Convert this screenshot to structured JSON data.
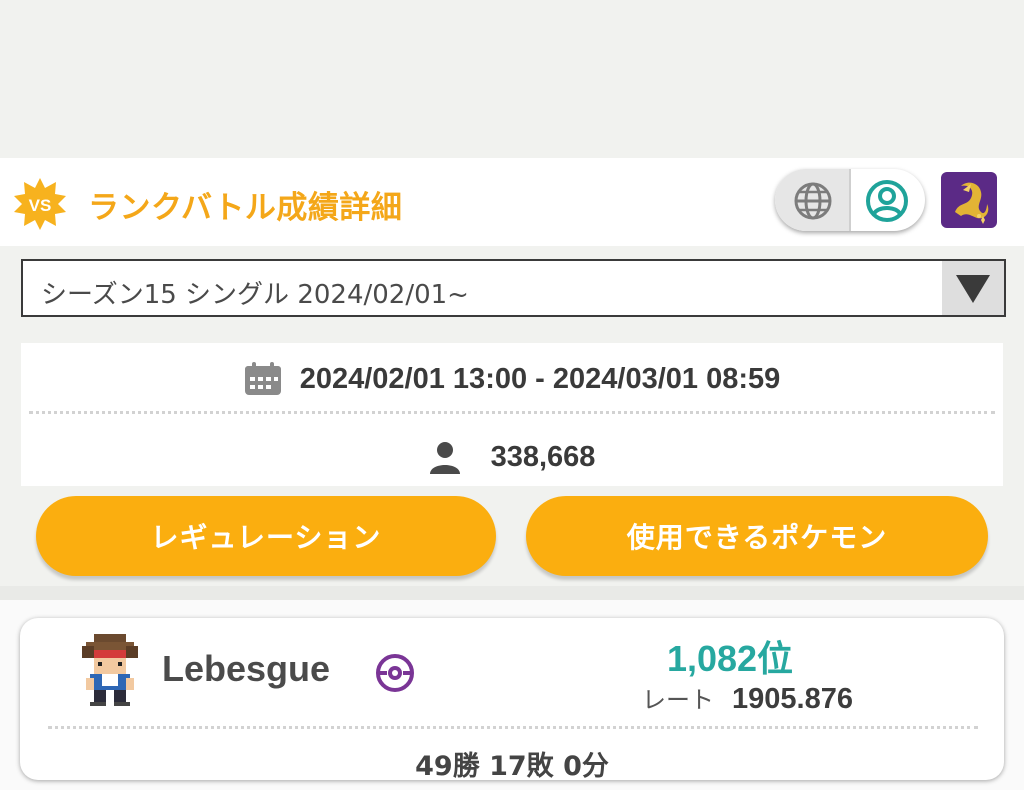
{
  "header": {
    "badge_text": "VS",
    "title": "ランクバトル成績詳細",
    "globe_icon": "globe-icon",
    "profile_icon": "user-circle-icon",
    "app_icon": "dragon-app-icon",
    "accent_color": "#f4a719"
  },
  "season_select": {
    "selected": "シーズン15 シングル 2024/02/01~"
  },
  "season_info": {
    "period": "2024/02/01 13:00 - 2024/03/01 08:59",
    "players": "338,668",
    "calendar_icon": "calendar-icon",
    "person_icon": "person-icon"
  },
  "buttons": {
    "regulation": "レギュレーション",
    "usable_pokemon": "使用できるポケモン",
    "color": "#fbae0f"
  },
  "player": {
    "name": "Lebesgue",
    "rank": "1,082位",
    "rate_label": "レート",
    "rate_value": "1905.876",
    "record": "49勝 17敗 0分",
    "rank_color": "#27a8a0"
  }
}
